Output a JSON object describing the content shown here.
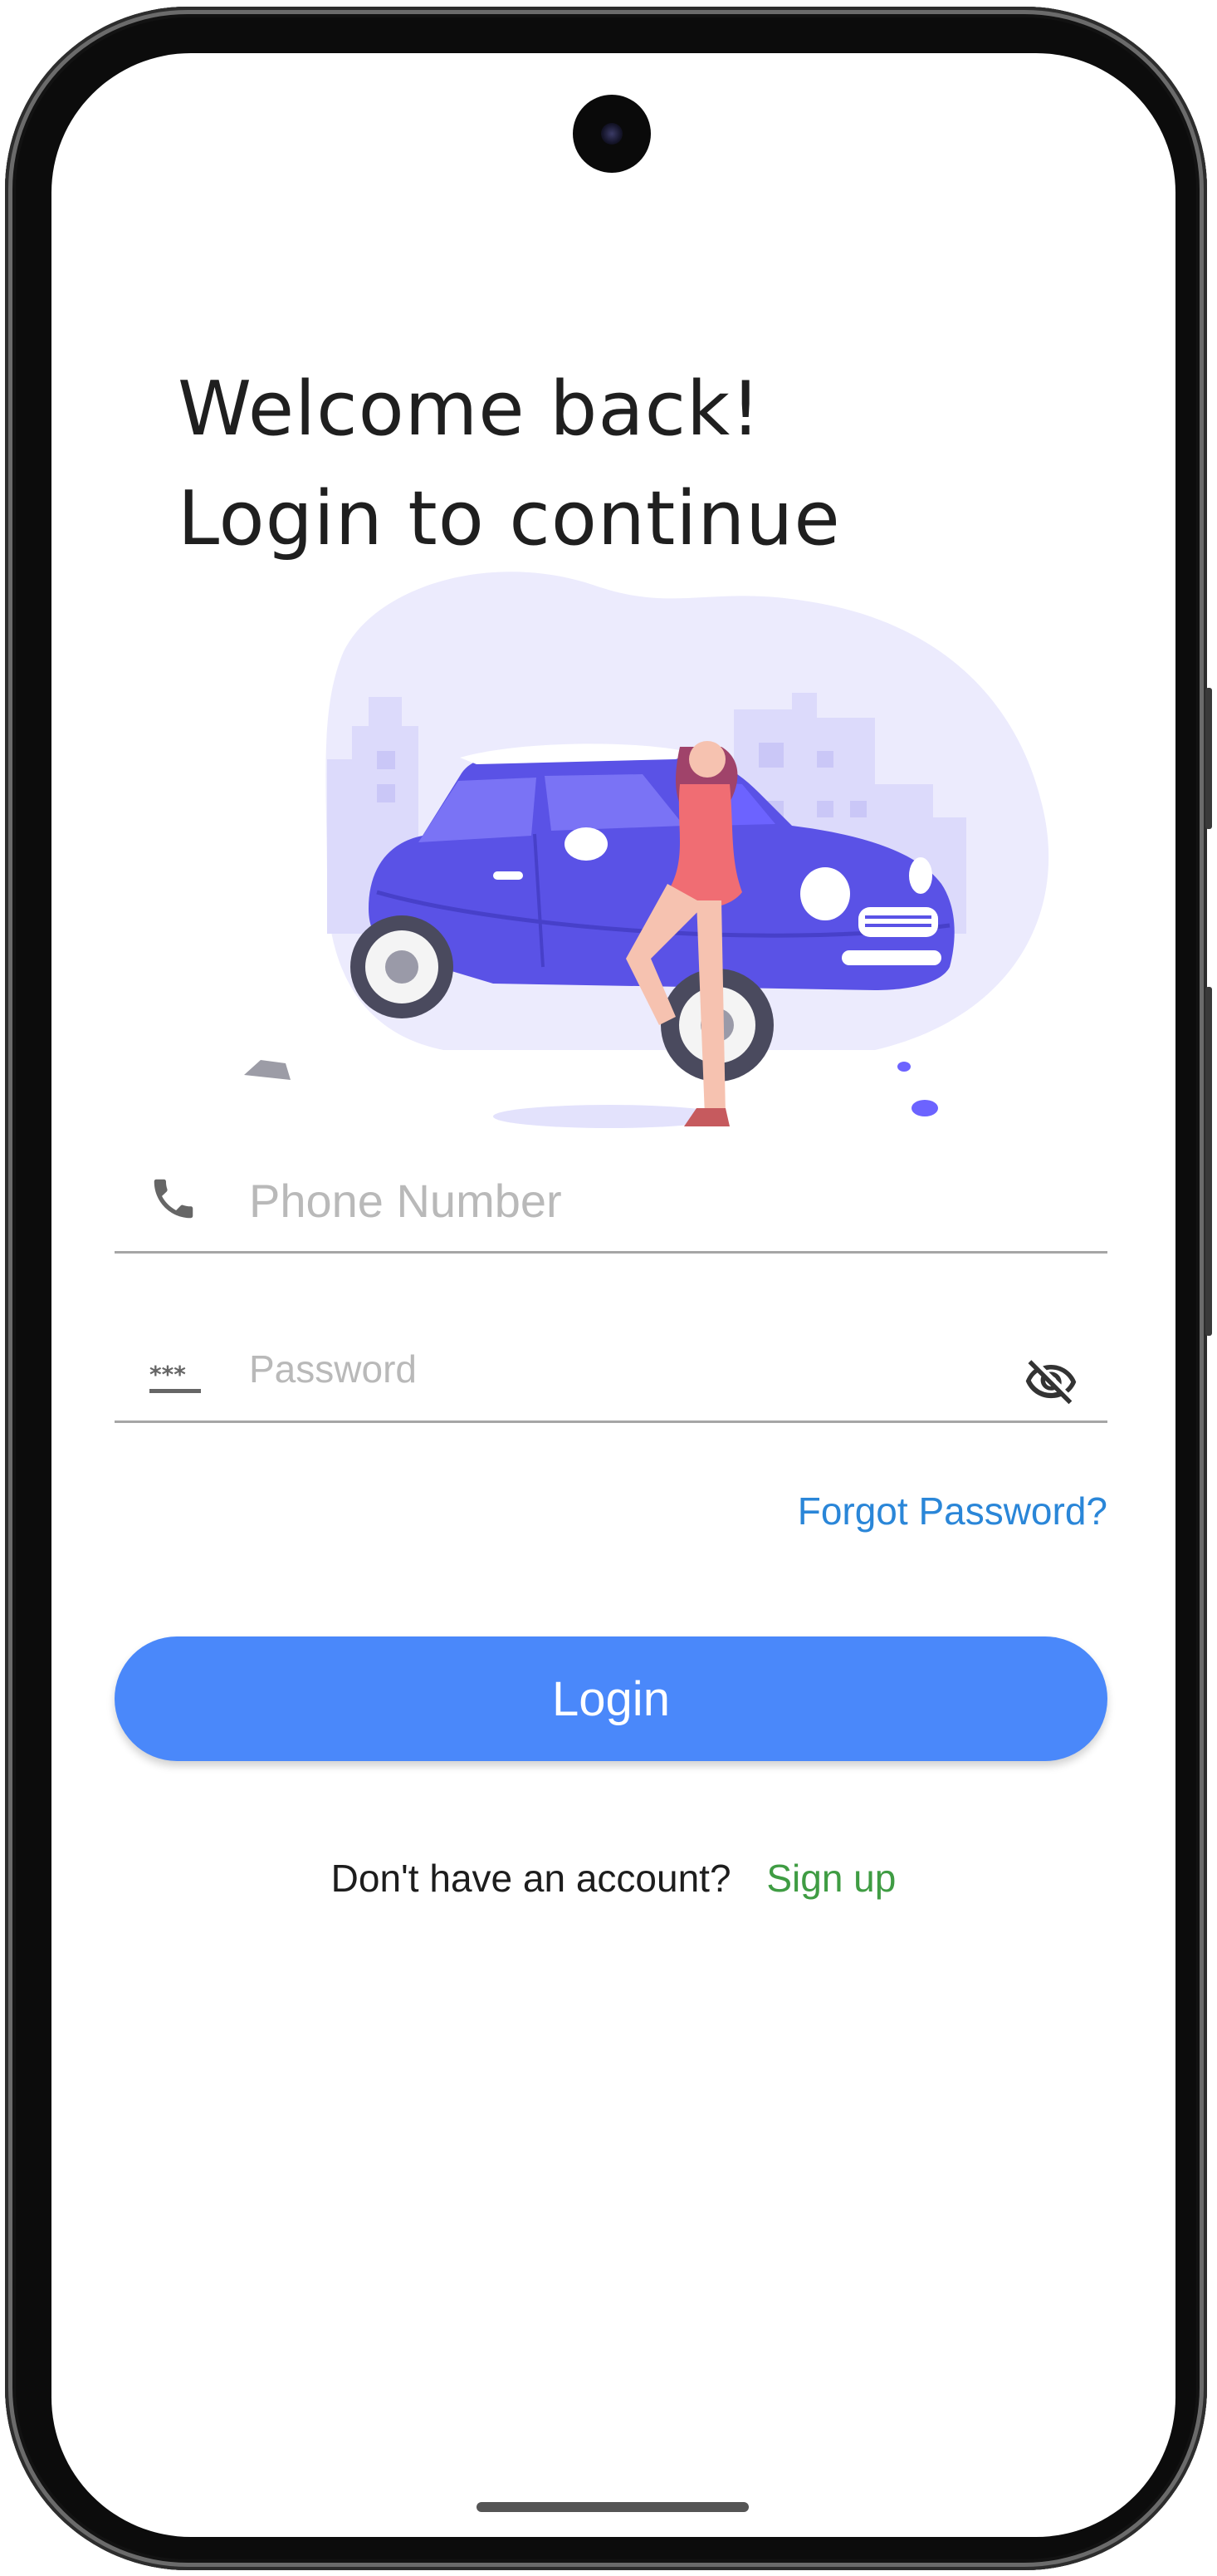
{
  "heading": {
    "line1": "Welcome back!",
    "line2": "Login to continue"
  },
  "form": {
    "phone": {
      "placeholder": "Phone Number",
      "value": "",
      "icon": "phone-icon"
    },
    "password": {
      "placeholder": "Password",
      "value": "",
      "icon": "password-dots-icon",
      "toggle_icon": "eye-off-icon"
    },
    "forgot_label": "Forgot Password?",
    "login_label": "Login"
  },
  "signup": {
    "prompt": "Don't have an account?",
    "link": "Sign up"
  },
  "colors": {
    "primary": "#4a88fa",
    "link_blue": "#2a86d8",
    "link_green": "#3f9c43",
    "illustration_accent": "#6c63ff",
    "illustration_person": "#f06d73"
  }
}
